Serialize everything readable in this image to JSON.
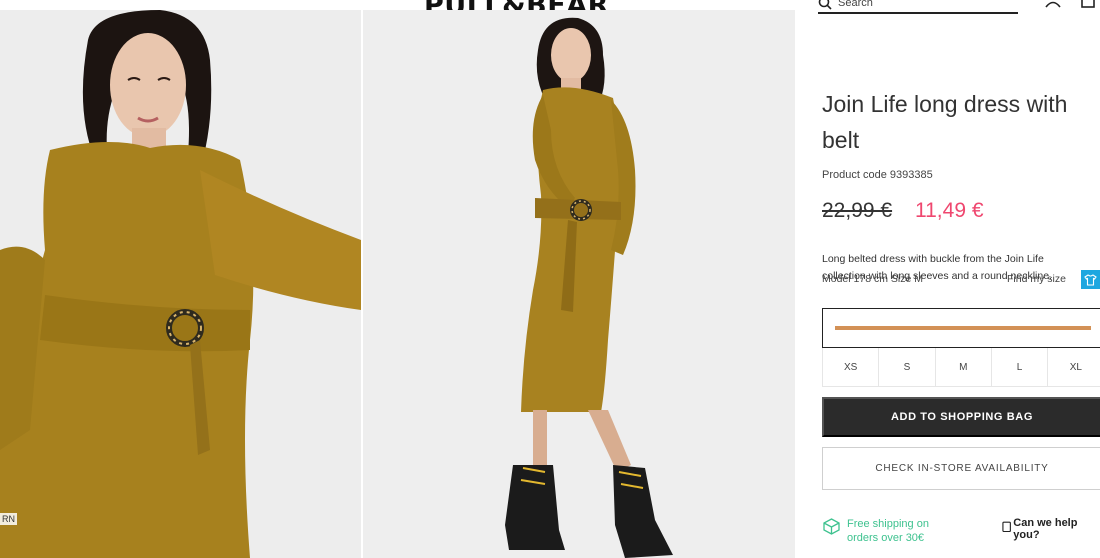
{
  "header": {
    "logo": "PULL&BEAR",
    "search_label": "Search",
    "user_icon": "user-icon",
    "bag_icon": "bag-icon"
  },
  "gallery": {
    "left_photo_label": "RN"
  },
  "product": {
    "title": "Join Life long dress with belt",
    "code": "Product code 9393385",
    "price_old": "22,99 €",
    "price_new": "11,49 €",
    "description": "Long belted dress with buckle from the Join Life collection with long sleeves and a round neckline.",
    "model": "Model 178 cm Size M",
    "find_size": "Find my size",
    "colors": {
      "swatch": "#d39156",
      "accent_sale": "#ef476f",
      "shipping_green": "#3ec28f"
    },
    "sizes": [
      "XS",
      "S",
      "M",
      "L",
      "XL"
    ],
    "add_button": "ADD TO SHOPPING BAG",
    "check_button": "CHECK IN-STORE AVAILABILITY",
    "shipping": "Free shipping on orders over 30€",
    "help": "Can we help you?"
  }
}
